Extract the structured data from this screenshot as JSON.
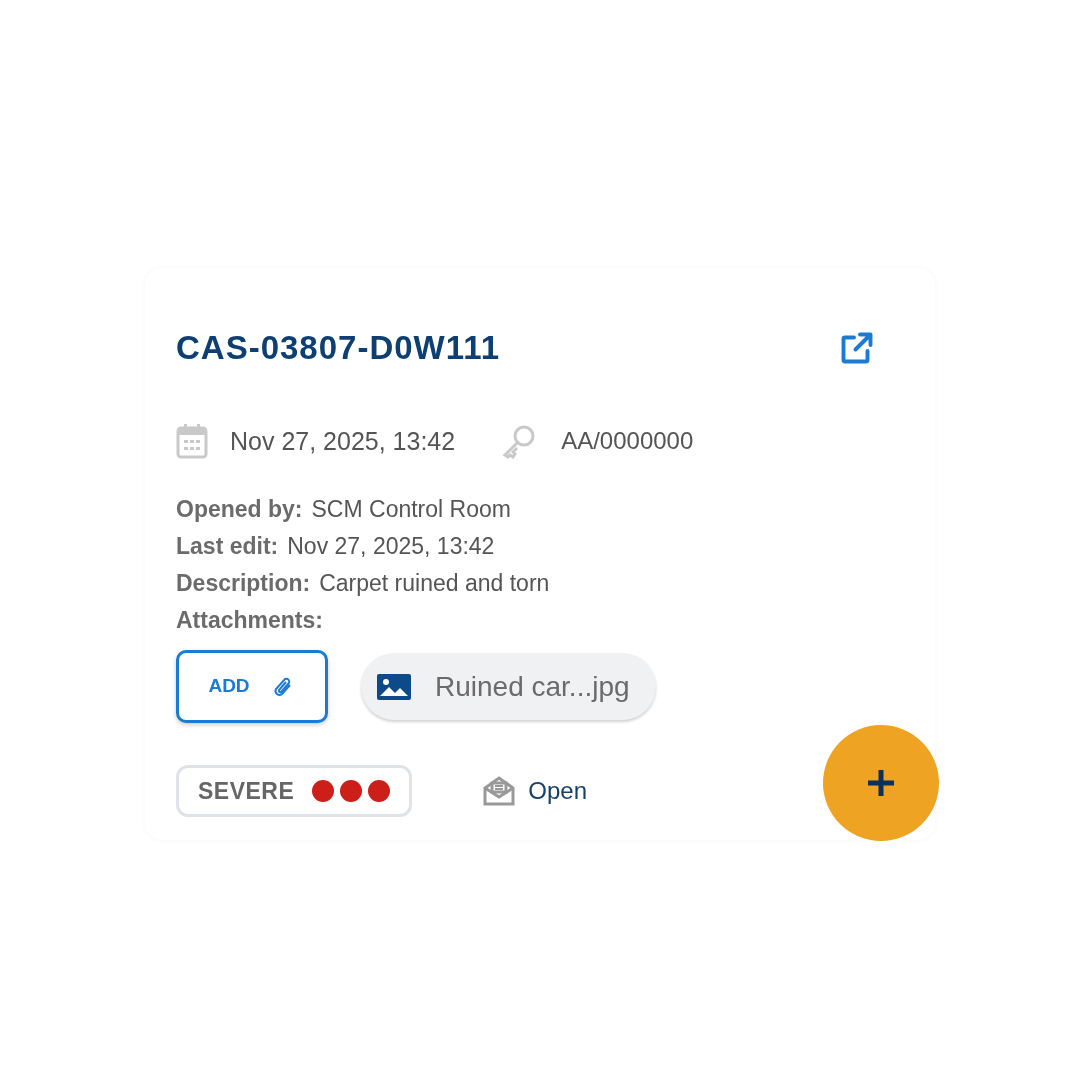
{
  "case_number": "CAS-03807-D0W111",
  "meta": {
    "date": "Nov 27, 2025, 13:42",
    "reference": "AA/0000000"
  },
  "details": [
    {
      "label": "Opened by:",
      "value": "SCM Control Room"
    },
    {
      "label": "Last edit:",
      "value": "Nov 27, 2025, 13:42"
    },
    {
      "label": "Description:",
      "value": "Carpet ruined and torn"
    },
    {
      "label": "Attachments:"
    }
  ],
  "add_button": "ADD",
  "attachments": [
    {
      "name": "Ruined car...jpg"
    }
  ],
  "severity": {
    "label": "SEVERE",
    "stars": 3
  },
  "status": "Open"
}
